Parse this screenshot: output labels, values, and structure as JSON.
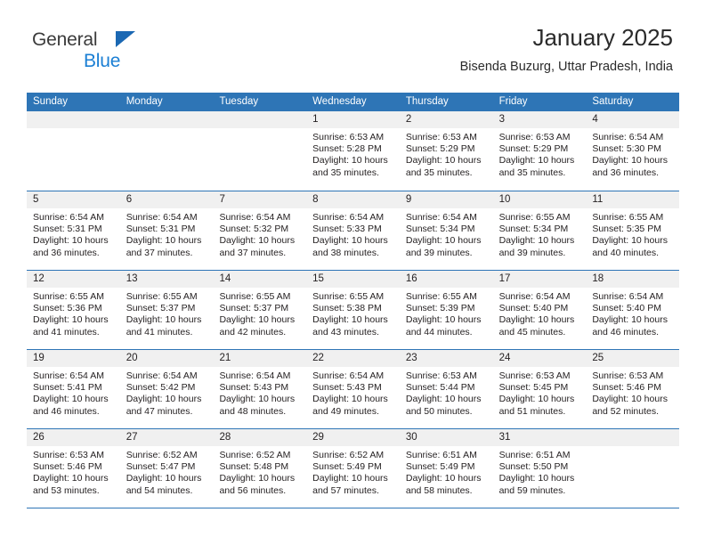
{
  "brand": {
    "name_line1": "General",
    "name_line2": "Blue",
    "triangle_color": "#1b68b3",
    "blue_text_color": "#1b7fd4"
  },
  "header": {
    "title": "January 2025",
    "subtitle": "Bisenda Buzurg, Uttar Pradesh, India"
  },
  "theme": {
    "header_blue": "#2e75b6",
    "day_band_gray": "#f0f0f0",
    "text_color": "#231f20"
  },
  "weekdays": [
    "Sunday",
    "Monday",
    "Tuesday",
    "Wednesday",
    "Thursday",
    "Friday",
    "Saturday"
  ],
  "weeks": [
    [
      {
        "day": "",
        "sunrise": "",
        "sunset": "",
        "daylight_line1": "",
        "daylight_line2": "",
        "empty": true
      },
      {
        "day": "",
        "sunrise": "",
        "sunset": "",
        "daylight_line1": "",
        "daylight_line2": "",
        "empty": true
      },
      {
        "day": "",
        "sunrise": "",
        "sunset": "",
        "daylight_line1": "",
        "daylight_line2": "",
        "empty": true
      },
      {
        "day": "1",
        "sunrise": "Sunrise: 6:53 AM",
        "sunset": "Sunset: 5:28 PM",
        "daylight_line1": "Daylight: 10 hours",
        "daylight_line2": "and 35 minutes.",
        "empty": false
      },
      {
        "day": "2",
        "sunrise": "Sunrise: 6:53 AM",
        "sunset": "Sunset: 5:29 PM",
        "daylight_line1": "Daylight: 10 hours",
        "daylight_line2": "and 35 minutes.",
        "empty": false
      },
      {
        "day": "3",
        "sunrise": "Sunrise: 6:53 AM",
        "sunset": "Sunset: 5:29 PM",
        "daylight_line1": "Daylight: 10 hours",
        "daylight_line2": "and 35 minutes.",
        "empty": false
      },
      {
        "day": "4",
        "sunrise": "Sunrise: 6:54 AM",
        "sunset": "Sunset: 5:30 PM",
        "daylight_line1": "Daylight: 10 hours",
        "daylight_line2": "and 36 minutes.",
        "empty": false
      }
    ],
    [
      {
        "day": "5",
        "sunrise": "Sunrise: 6:54 AM",
        "sunset": "Sunset: 5:31 PM",
        "daylight_line1": "Daylight: 10 hours",
        "daylight_line2": "and 36 minutes.",
        "empty": false
      },
      {
        "day": "6",
        "sunrise": "Sunrise: 6:54 AM",
        "sunset": "Sunset: 5:31 PM",
        "daylight_line1": "Daylight: 10 hours",
        "daylight_line2": "and 37 minutes.",
        "empty": false
      },
      {
        "day": "7",
        "sunrise": "Sunrise: 6:54 AM",
        "sunset": "Sunset: 5:32 PM",
        "daylight_line1": "Daylight: 10 hours",
        "daylight_line2": "and 37 minutes.",
        "empty": false
      },
      {
        "day": "8",
        "sunrise": "Sunrise: 6:54 AM",
        "sunset": "Sunset: 5:33 PM",
        "daylight_line1": "Daylight: 10 hours",
        "daylight_line2": "and 38 minutes.",
        "empty": false
      },
      {
        "day": "9",
        "sunrise": "Sunrise: 6:54 AM",
        "sunset": "Sunset: 5:34 PM",
        "daylight_line1": "Daylight: 10 hours",
        "daylight_line2": "and 39 minutes.",
        "empty": false
      },
      {
        "day": "10",
        "sunrise": "Sunrise: 6:55 AM",
        "sunset": "Sunset: 5:34 PM",
        "daylight_line1": "Daylight: 10 hours",
        "daylight_line2": "and 39 minutes.",
        "empty": false
      },
      {
        "day": "11",
        "sunrise": "Sunrise: 6:55 AM",
        "sunset": "Sunset: 5:35 PM",
        "daylight_line1": "Daylight: 10 hours",
        "daylight_line2": "and 40 minutes.",
        "empty": false
      }
    ],
    [
      {
        "day": "12",
        "sunrise": "Sunrise: 6:55 AM",
        "sunset": "Sunset: 5:36 PM",
        "daylight_line1": "Daylight: 10 hours",
        "daylight_line2": "and 41 minutes.",
        "empty": false
      },
      {
        "day": "13",
        "sunrise": "Sunrise: 6:55 AM",
        "sunset": "Sunset: 5:37 PM",
        "daylight_line1": "Daylight: 10 hours",
        "daylight_line2": "and 41 minutes.",
        "empty": false
      },
      {
        "day": "14",
        "sunrise": "Sunrise: 6:55 AM",
        "sunset": "Sunset: 5:37 PM",
        "daylight_line1": "Daylight: 10 hours",
        "daylight_line2": "and 42 minutes.",
        "empty": false
      },
      {
        "day": "15",
        "sunrise": "Sunrise: 6:55 AM",
        "sunset": "Sunset: 5:38 PM",
        "daylight_line1": "Daylight: 10 hours",
        "daylight_line2": "and 43 minutes.",
        "empty": false
      },
      {
        "day": "16",
        "sunrise": "Sunrise: 6:55 AM",
        "sunset": "Sunset: 5:39 PM",
        "daylight_line1": "Daylight: 10 hours",
        "daylight_line2": "and 44 minutes.",
        "empty": false
      },
      {
        "day": "17",
        "sunrise": "Sunrise: 6:54 AM",
        "sunset": "Sunset: 5:40 PM",
        "daylight_line1": "Daylight: 10 hours",
        "daylight_line2": "and 45 minutes.",
        "empty": false
      },
      {
        "day": "18",
        "sunrise": "Sunrise: 6:54 AM",
        "sunset": "Sunset: 5:40 PM",
        "daylight_line1": "Daylight: 10 hours",
        "daylight_line2": "and 46 minutes.",
        "empty": false
      }
    ],
    [
      {
        "day": "19",
        "sunrise": "Sunrise: 6:54 AM",
        "sunset": "Sunset: 5:41 PM",
        "daylight_line1": "Daylight: 10 hours",
        "daylight_line2": "and 46 minutes.",
        "empty": false
      },
      {
        "day": "20",
        "sunrise": "Sunrise: 6:54 AM",
        "sunset": "Sunset: 5:42 PM",
        "daylight_line1": "Daylight: 10 hours",
        "daylight_line2": "and 47 minutes.",
        "empty": false
      },
      {
        "day": "21",
        "sunrise": "Sunrise: 6:54 AM",
        "sunset": "Sunset: 5:43 PM",
        "daylight_line1": "Daylight: 10 hours",
        "daylight_line2": "and 48 minutes.",
        "empty": false
      },
      {
        "day": "22",
        "sunrise": "Sunrise: 6:54 AM",
        "sunset": "Sunset: 5:43 PM",
        "daylight_line1": "Daylight: 10 hours",
        "daylight_line2": "and 49 minutes.",
        "empty": false
      },
      {
        "day": "23",
        "sunrise": "Sunrise: 6:53 AM",
        "sunset": "Sunset: 5:44 PM",
        "daylight_line1": "Daylight: 10 hours",
        "daylight_line2": "and 50 minutes.",
        "empty": false
      },
      {
        "day": "24",
        "sunrise": "Sunrise: 6:53 AM",
        "sunset": "Sunset: 5:45 PM",
        "daylight_line1": "Daylight: 10 hours",
        "daylight_line2": "and 51 minutes.",
        "empty": false
      },
      {
        "day": "25",
        "sunrise": "Sunrise: 6:53 AM",
        "sunset": "Sunset: 5:46 PM",
        "daylight_line1": "Daylight: 10 hours",
        "daylight_line2": "and 52 minutes.",
        "empty": false
      }
    ],
    [
      {
        "day": "26",
        "sunrise": "Sunrise: 6:53 AM",
        "sunset": "Sunset: 5:46 PM",
        "daylight_line1": "Daylight: 10 hours",
        "daylight_line2": "and 53 minutes.",
        "empty": false
      },
      {
        "day": "27",
        "sunrise": "Sunrise: 6:52 AM",
        "sunset": "Sunset: 5:47 PM",
        "daylight_line1": "Daylight: 10 hours",
        "daylight_line2": "and 54 minutes.",
        "empty": false
      },
      {
        "day": "28",
        "sunrise": "Sunrise: 6:52 AM",
        "sunset": "Sunset: 5:48 PM",
        "daylight_line1": "Daylight: 10 hours",
        "daylight_line2": "and 56 minutes.",
        "empty": false
      },
      {
        "day": "29",
        "sunrise": "Sunrise: 6:52 AM",
        "sunset": "Sunset: 5:49 PM",
        "daylight_line1": "Daylight: 10 hours",
        "daylight_line2": "and 57 minutes.",
        "empty": false
      },
      {
        "day": "30",
        "sunrise": "Sunrise: 6:51 AM",
        "sunset": "Sunset: 5:49 PM",
        "daylight_line1": "Daylight: 10 hours",
        "daylight_line2": "and 58 minutes.",
        "empty": false
      },
      {
        "day": "31",
        "sunrise": "Sunrise: 6:51 AM",
        "sunset": "Sunset: 5:50 PM",
        "daylight_line1": "Daylight: 10 hours",
        "daylight_line2": "and 59 minutes.",
        "empty": false
      },
      {
        "day": "",
        "sunrise": "",
        "sunset": "",
        "daylight_line1": "",
        "daylight_line2": "",
        "empty": true
      }
    ]
  ]
}
